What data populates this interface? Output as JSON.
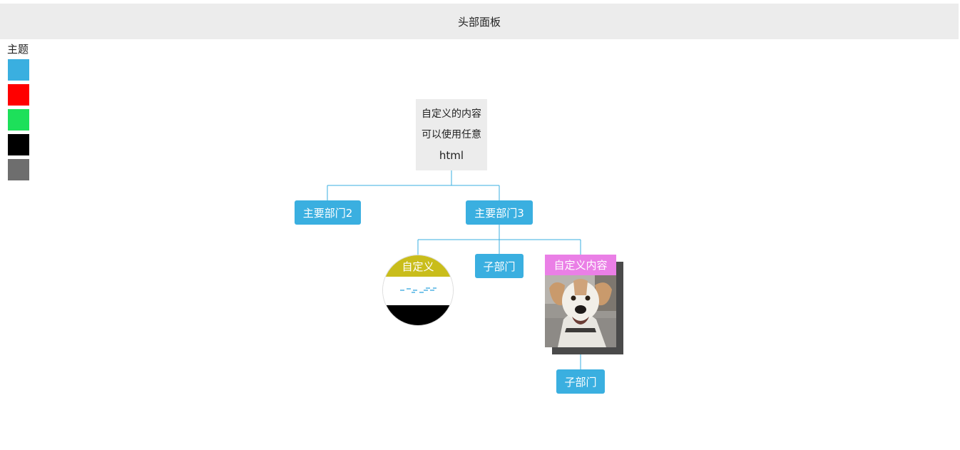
{
  "header": {
    "title": "头部面板"
  },
  "theme_panel": {
    "title": "主题",
    "swatches": [
      {
        "name": "blue",
        "color": "#3aafe0"
      },
      {
        "name": "red",
        "color": "#ff0000"
      },
      {
        "name": "green",
        "color": "#1de05a"
      },
      {
        "name": "black",
        "color": "#000000"
      },
      {
        "name": "gray",
        "color": "#6e6e6e"
      }
    ]
  },
  "chart": {
    "root": {
      "lines": [
        "自定义的内容",
        "可以使用任意",
        "html"
      ]
    },
    "level1": [
      {
        "label": "主要部门2"
      },
      {
        "label": "主要部门3"
      }
    ],
    "level2": {
      "circle_node": {
        "label": "自定义"
      },
      "sub_node": {
        "label": "子部门"
      },
      "card_node": {
        "label": "自定义内容",
        "image": "dog-photo"
      }
    },
    "level3": {
      "sub_node": {
        "label": "子部门"
      }
    },
    "colors": {
      "accent": "#3aafe0",
      "root_bg": "#ececec",
      "circle_top": "#c9bd1b",
      "card_title": "#ea7fe6"
    }
  }
}
